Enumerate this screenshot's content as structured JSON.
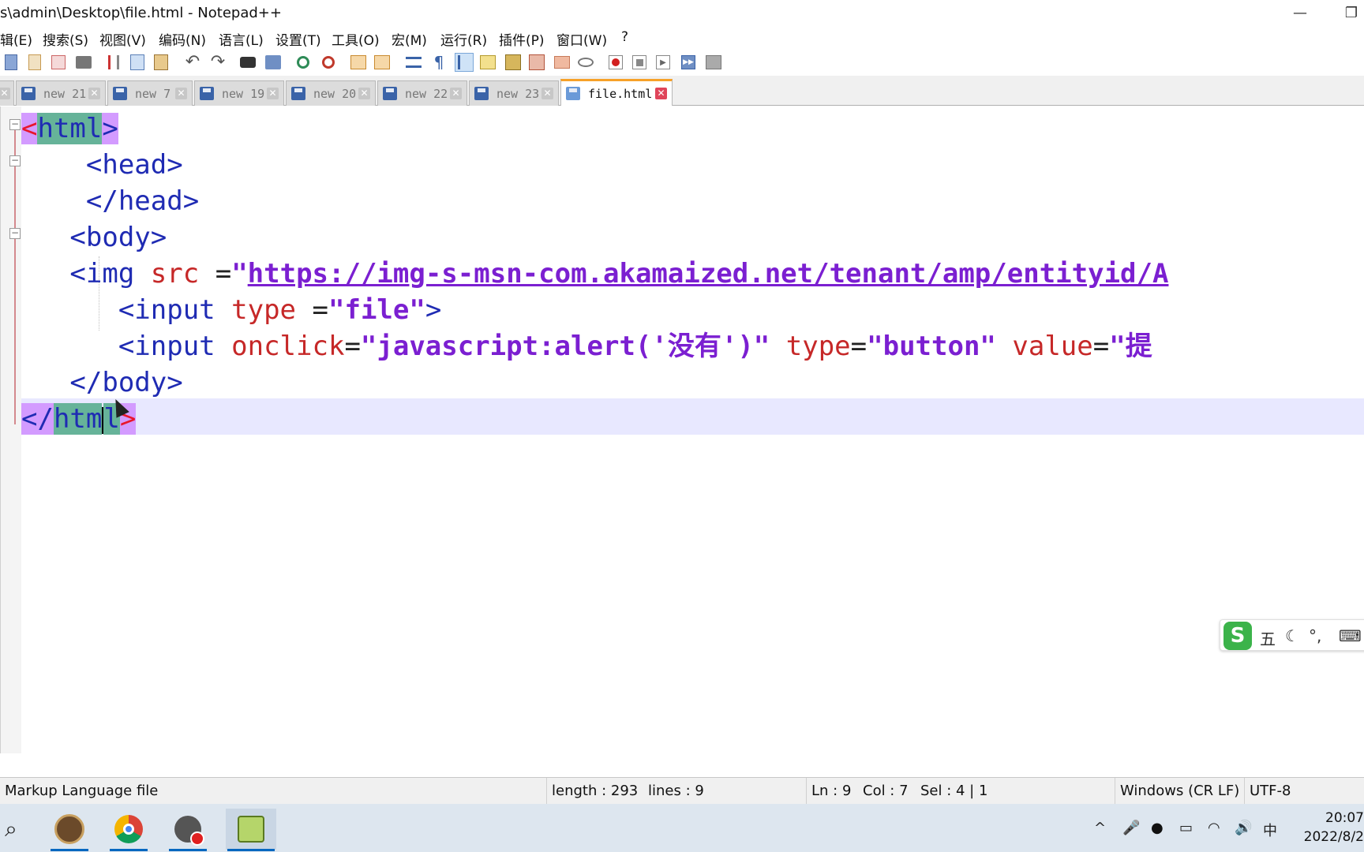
{
  "window": {
    "title": "s\\admin\\Desktop\\file.html - Notepad++",
    "minimize_glyph": "—",
    "restore_glyph": "❐"
  },
  "menu": [
    "辑(E)",
    "搜索(S)",
    "视图(V)",
    "编码(N)",
    "语言(L)",
    "设置(T)",
    "工具(O)",
    "宏(M)",
    "运行(R)",
    "插件(P)",
    "窗口(W)",
    "?"
  ],
  "toolbar": {
    "icons": [
      "new-file-icon",
      "open-file-icon",
      "save-icon",
      "save-all-icon",
      "close-icon",
      "close-all-icon",
      "print-icon",
      "cut-icon",
      "copy-icon",
      "paste-icon",
      "undo-icon",
      "redo-icon",
      "find-icon",
      "replace-icon",
      "zoom-in-icon",
      "zoom-out-icon",
      "sync-vertical-icon",
      "sync-horizontal-icon",
      "word-wrap-icon",
      "show-all-chars-icon",
      "indent-guide-icon",
      "user-define-language-icon",
      "document-map-icon",
      "function-list-icon",
      "folder-workspace-icon",
      "monitoring-icon",
      "record-macro-icon",
      "stop-macro-icon",
      "play-macro-icon",
      "run-macro-multiple-icon",
      "save-macro-icon"
    ]
  },
  "tabs": [
    {
      "label": "",
      "active": false
    },
    {
      "label": "new 21",
      "active": false
    },
    {
      "label": "new 7",
      "active": false
    },
    {
      "label": "new 19",
      "active": false
    },
    {
      "label": "new 20",
      "active": false
    },
    {
      "label": "new 22",
      "active": false
    },
    {
      "label": "new 23",
      "active": false
    },
    {
      "label": "file.html",
      "active": true
    }
  ],
  "tab_close_glyph": "✕",
  "editor": {
    "lines": [
      {
        "t1": "<",
        "t2": "html",
        "t3": ">"
      },
      {
        "t1": "<head>"
      },
      {
        "t1": "</head>"
      },
      {
        "t1": "<body>"
      },
      {
        "t1": "<img",
        "a1": "src",
        "e1": "=",
        "s1": "\"",
        "s2": "https://img-s-msn-com.akamaized.net/tenant/amp/entityid/A"
      },
      {
        "t1": "<input",
        "a1": "type",
        "e1": "=",
        "s1": "\"file\"",
        "t2": ">"
      },
      {
        "t1": "<input",
        "a1": "onclick",
        "e1": "=",
        "s1": "\"javascript:alert('没有')\"",
        "a2": "type",
        "e2": "=",
        "s2": "\"button\"",
        "a3": "value",
        "e3": "=",
        "s3": "\"提"
      },
      {
        "t1": "</body>"
      },
      {
        "t1": "</",
        "t2": "htm",
        "t3": "l",
        "t4": ">"
      }
    ],
    "fold_minus": "−"
  },
  "ime": {
    "logo": "S",
    "mode": "五",
    "moon": "☾",
    "punct": "°,",
    "keyboard": "⌨"
  },
  "status": {
    "file_type": "Markup Language file",
    "length": "length : 293",
    "lines": "lines : 9",
    "ln": "Ln : 9",
    "col": "Col : 7",
    "sel": "Sel : 4 | 1",
    "eol": "Windows (CR LF)",
    "encoding": "UTF-8"
  },
  "taskbar": {
    "search_glyph": "⌕",
    "tray": {
      "chevron": "^",
      "mic": "🎤",
      "qq": "●",
      "battery": "▭",
      "wifi": "◠",
      "volume": "🔊",
      "lang": "中"
    },
    "time": "20:07",
    "date": "2022/8/2"
  }
}
